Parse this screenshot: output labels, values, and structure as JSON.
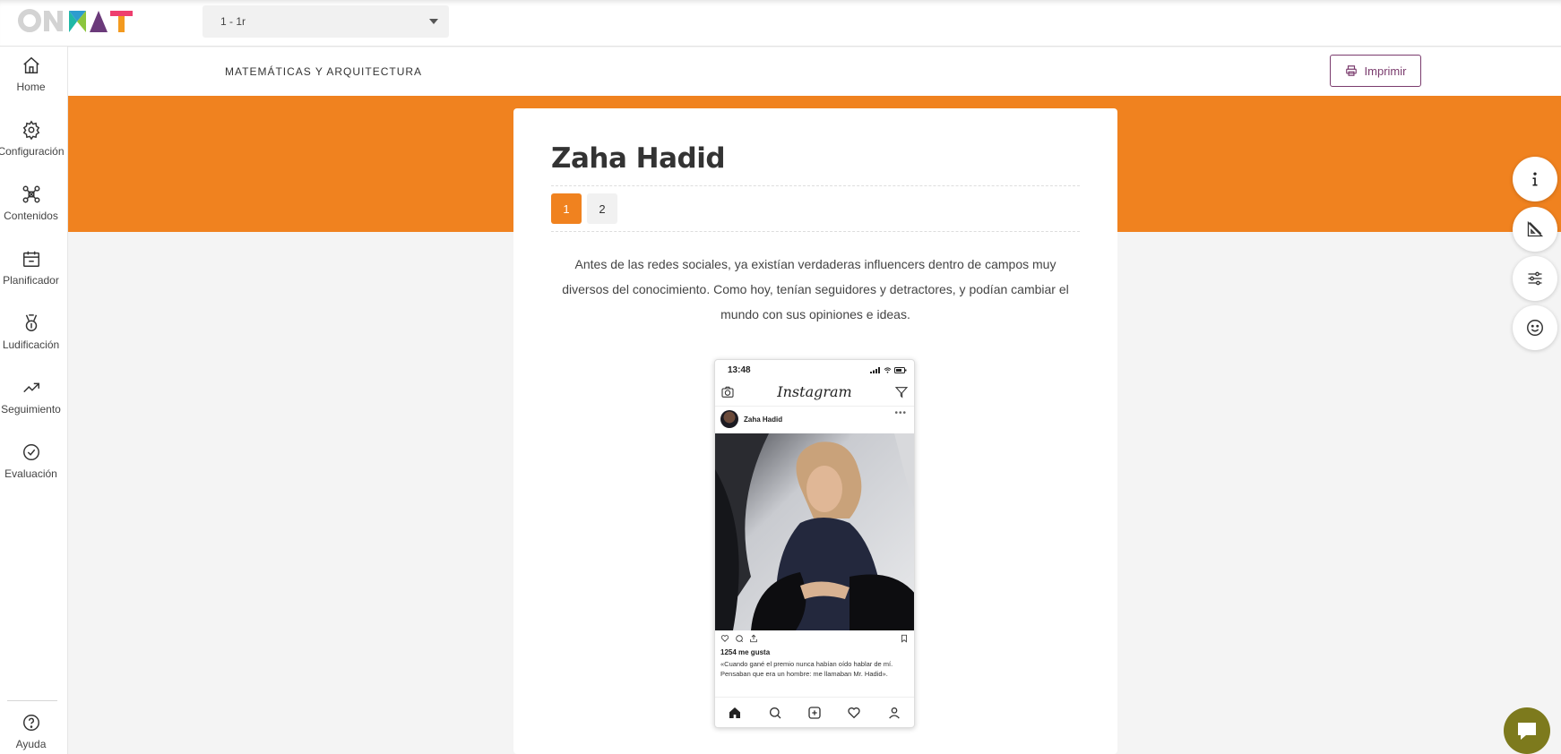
{
  "app": {
    "logo_text": "ONMAT"
  },
  "topbar": {
    "group_selector": "1 - 1r"
  },
  "sidebar": {
    "items": [
      {
        "label": "Home",
        "icon": "home-icon"
      },
      {
        "label": "Configuración",
        "icon": "gear-icon"
      },
      {
        "label": "Contenidos",
        "icon": "nodes-icon"
      },
      {
        "label": "Planificador",
        "icon": "calendar-icon"
      },
      {
        "label": "Ludificación",
        "icon": "medal-icon"
      },
      {
        "label": "Seguimiento",
        "icon": "trend-icon"
      },
      {
        "label": "Evaluación",
        "icon": "check-circle-icon"
      }
    ],
    "help_label": "Ayuda"
  },
  "subheader": {
    "breadcrumb": "MATEMÁTICAS Y ARQUITECTURA",
    "print_label": "Imprimir"
  },
  "content": {
    "title": "Zaha Hadid",
    "pages": [
      "1",
      "2"
    ],
    "active_page": "1",
    "intro": "Antes de las redes sociales, ya existían verdaderas influencers dentro de campos muy diversos del conocimiento. Como hoy, tenían seguidores y detractores, y podían cambiar el mundo con sus opiniones e ideas."
  },
  "phone": {
    "time": "13:48",
    "brand": "Instagram",
    "username": "Zaha Hadid",
    "likes": "1254 me gusta",
    "caption": "«Cuando gané el premio nunca habían oído hablar de mí. Pensaban que era un hombre: me llamaban Mr. Hadid»."
  },
  "floating_buttons": [
    {
      "icon": "info-icon"
    },
    {
      "icon": "ruler-icon"
    },
    {
      "icon": "sliders-icon"
    },
    {
      "icon": "smiley-icon"
    }
  ],
  "colors": {
    "accent_orange": "#f0821f",
    "brand_purple": "#7a3b6d",
    "chat_olive": "#7d7a1d"
  }
}
